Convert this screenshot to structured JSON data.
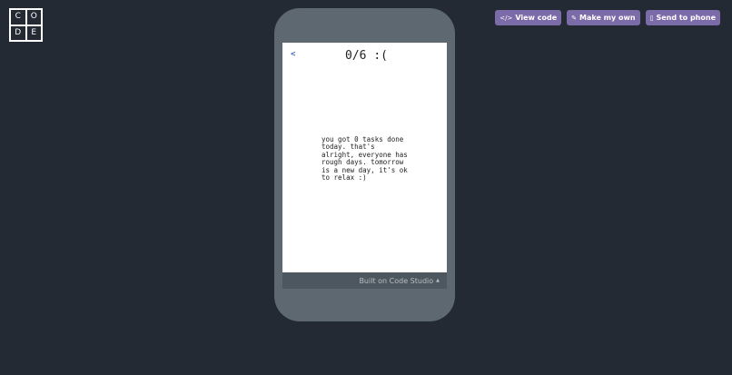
{
  "logo": {
    "letters": [
      "C",
      "O",
      "D",
      "E"
    ]
  },
  "toolbar": {
    "view_code": {
      "icon": "code-icon",
      "glyph": "</>",
      "label": "View code"
    },
    "make_my_own": {
      "icon": "edit-icon",
      "glyph": "✎",
      "label": "Make my own"
    },
    "send_to_phone": {
      "icon": "phone-icon",
      "glyph": "▯",
      "label": "Send to phone"
    }
  },
  "app": {
    "back_label": "<",
    "score": "0/6 :(",
    "message": "you got 0 tasks done\ntoday. that's\nalright, everyone has\nrough days. tomorrow\nis a new day, it's ok\nto relax :)"
  },
  "footer": {
    "built_on": "Built on Code Studio",
    "caret_icon": "caret-up-icon"
  },
  "colors": {
    "background": "#242a33",
    "button": "#7c6ba9",
    "phone_frame": "#5e6870",
    "back_link": "#3b6bc4"
  }
}
